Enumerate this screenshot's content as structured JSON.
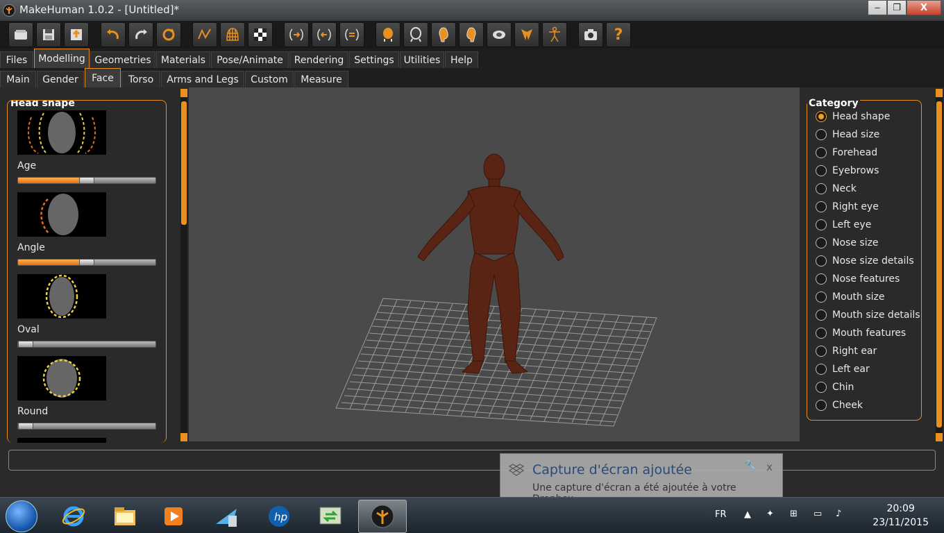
{
  "window": {
    "title": "MakeHuman 1.0.2 - [Untitled]*",
    "minimize_label": "‒",
    "maximize_label": "❐",
    "close_label": "X"
  },
  "toolbar": {
    "icons": [
      "open-icon",
      "save-icon",
      "export-icon",
      "undo-icon",
      "redo-icon",
      "reset-icon",
      "smooth-icon",
      "wireframe-icon",
      "background-icon",
      "pose-left-icon",
      "pose-right-icon",
      "pose-center-icon",
      "face-front-icon",
      "face-back-icon",
      "face-left-icon",
      "face-right-icon",
      "face-top-icon",
      "face-bottom-icon",
      "skeleton-icon",
      "screenshot-icon",
      "help-icon"
    ],
    "help_label": "?"
  },
  "menu": {
    "tabs": [
      "Files",
      "Modelling",
      "Geometries",
      "Materials",
      "Pose/Animate",
      "Rendering",
      "Settings",
      "Utilities",
      "Help"
    ],
    "active": "Modelling"
  },
  "submenu": {
    "tabs": [
      "Main",
      "Gender",
      "Face",
      "Torso",
      "Arms and Legs",
      "Custom",
      "Measure"
    ],
    "active": "Face"
  },
  "left_panel": {
    "title": "Head shape",
    "sliders": [
      {
        "label": "Age",
        "value": 0.5
      },
      {
        "label": "Angle",
        "value": 0.5
      },
      {
        "label": "Oval",
        "value": 0.0
      },
      {
        "label": "Round",
        "value": 0.0
      }
    ]
  },
  "category": {
    "title": "Category",
    "items": [
      "Head shape",
      "Head size",
      "Forehead",
      "Eyebrows",
      "Neck",
      "Right eye",
      "Left eye",
      "Nose size",
      "Nose size details",
      "Nose features",
      "Mouth size",
      "Mouth size details",
      "Mouth features",
      "Right ear",
      "Left ear",
      "Chin",
      "Cheek"
    ],
    "selected": "Head shape"
  },
  "status": {
    "text": ""
  },
  "notification": {
    "title": "Capture d'écran ajoutée",
    "body": "Une capture d'écran a été ajoutée à votre Dropbox.",
    "close": "x"
  },
  "taskbar": {
    "language": "FR",
    "time": "20:09",
    "date": "23/11/2015",
    "apps": [
      "ie-icon",
      "explorer-icon",
      "media-player-icon",
      "network-icon",
      "hp-icon",
      "sync-icon",
      "makehuman-icon"
    ]
  },
  "colors": {
    "accent": "#e89020",
    "skin": "#5a2414",
    "background": "#4a4a4a"
  }
}
